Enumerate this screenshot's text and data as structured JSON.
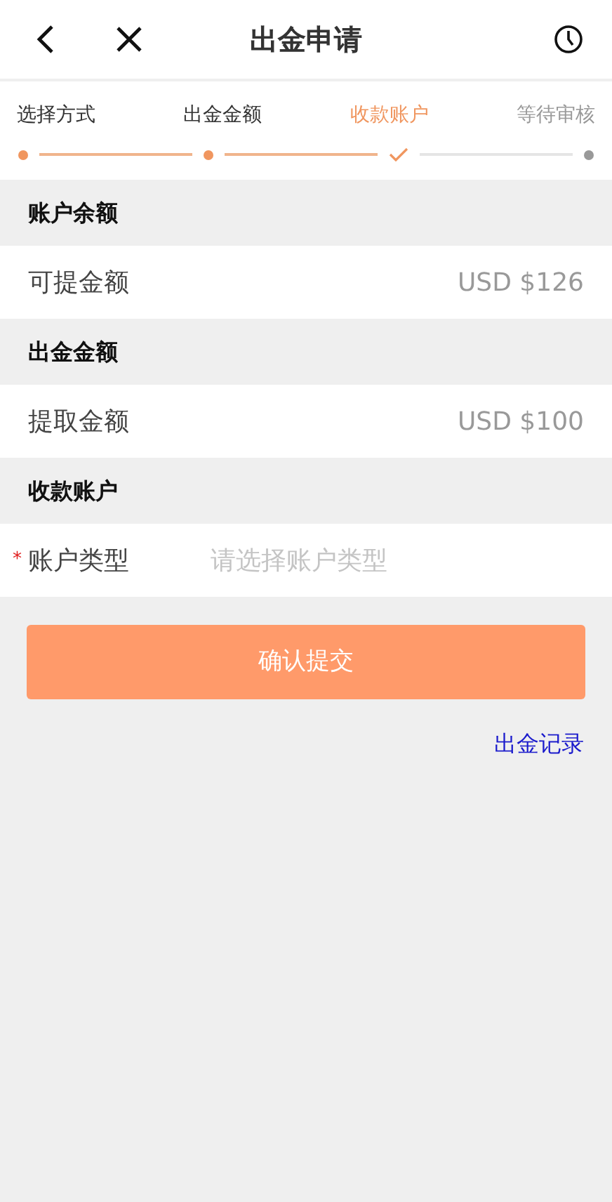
{
  "header": {
    "title": "出金申请"
  },
  "steps": [
    {
      "label": "选择方式",
      "kind": "done"
    },
    {
      "label": "出金金额",
      "kind": "done"
    },
    {
      "label": "收款账户",
      "kind": "current"
    },
    {
      "label": "等待审核",
      "kind": "pending"
    }
  ],
  "sections": [
    {
      "title": "账户余额",
      "rows": [
        {
          "kind": "value",
          "label": "可提金额",
          "value": "USD $126"
        }
      ]
    },
    {
      "title": "出金金额",
      "rows": [
        {
          "kind": "value",
          "label": "提取金额",
          "value": "USD $100"
        }
      ]
    },
    {
      "title": "收款账户",
      "rows": [
        {
          "kind": "select",
          "label": "账户类型",
          "required": true,
          "required_mark": "*",
          "placeholder": "请选择账户类型"
        }
      ]
    }
  ],
  "submit_button": "确认提交",
  "records_link": "出金记录"
}
